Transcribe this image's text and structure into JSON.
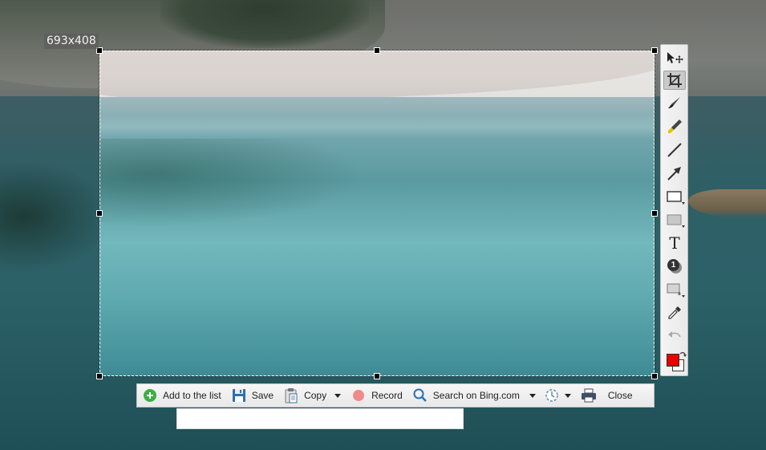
{
  "selection": {
    "size_label": "693x408"
  },
  "tools": [
    {
      "name": "select-move",
      "icon": "select-move-icon"
    },
    {
      "name": "crop",
      "icon": "crop-icon",
      "active": true
    },
    {
      "name": "pen",
      "icon": "pen-icon"
    },
    {
      "name": "highlighter",
      "icon": "highlighter-icon"
    },
    {
      "name": "line",
      "icon": "line-icon"
    },
    {
      "name": "arrow",
      "icon": "arrow-icon"
    },
    {
      "name": "rectangle",
      "icon": "rectangle-icon"
    },
    {
      "name": "filled-rectangle",
      "icon": "filled-rectangle-icon"
    },
    {
      "name": "text",
      "icon": "text-icon",
      "glyph": "T"
    },
    {
      "name": "step-number",
      "icon": "step-number-icon",
      "glyph": "1"
    },
    {
      "name": "effects",
      "icon": "effects-icon"
    },
    {
      "name": "color-picker",
      "icon": "eyedropper-icon"
    },
    {
      "name": "undo",
      "icon": "undo-icon"
    },
    {
      "name": "colors",
      "icon": "color-swatch-icon"
    }
  ],
  "colors": {
    "primary": "#e60000",
    "secondary": "#ffffff"
  },
  "actions": {
    "add_to_list": "Add to the list",
    "save": "Save",
    "copy": "Copy",
    "record": "Record",
    "search": "Search on Bing.com",
    "close": "Close"
  }
}
